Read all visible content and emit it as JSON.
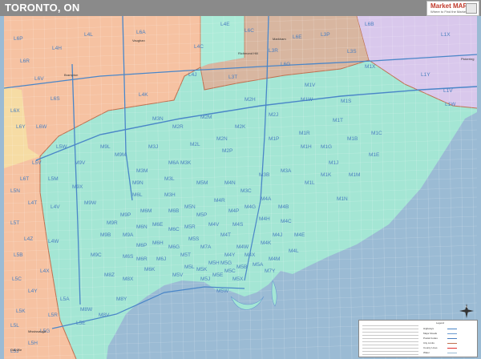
{
  "title": "TORONTO, ON",
  "logo": {
    "brand": "Market MAPS",
    "tagline": "Where to Find the Market"
  },
  "colors": {
    "water": "#9bbbd4",
    "toronto": "#a4e6d4",
    "mississauga": "#f6c2a2",
    "vaughan": "#acebd8",
    "markham": "#d8b6a0",
    "pickering": "#d9c8ec",
    "peel_south": "#f6dca4",
    "label": "#4a7fc0",
    "road": "#6a9ad0",
    "boundary": "#c07050"
  },
  "postal_labels": [
    "L4L",
    "L6A",
    "L4H",
    "L4J",
    "L4C",
    "L3R",
    "L3P",
    "L6E",
    "L6B",
    "L6G",
    "L3S",
    "L1X",
    "L4K",
    "L4E",
    "L6C",
    "L3T",
    "L1Y",
    "L6P",
    "L6R",
    "L6V",
    "L6X",
    "L6S",
    "L6W",
    "L6Y",
    "L6T",
    "L4T",
    "L5T",
    "L4V",
    "L4W",
    "L4X",
    "L4Y",
    "L4Z",
    "L5B",
    "L5C",
    "L5K",
    "L5L",
    "L5M",
    "L5N",
    "L5V",
    "L5W",
    "L5R",
    "L5A",
    "L5E",
    "L5G",
    "L5H",
    "L5J",
    "L1V",
    "L1W",
    "M9L",
    "M3N",
    "M3J",
    "M2N",
    "M2H",
    "M2M",
    "M2L",
    "M2J",
    "M2K",
    "M2P",
    "M1X",
    "M1V",
    "M1W",
    "M1S",
    "M1T",
    "M1R",
    "M1P",
    "M1B",
    "M1C",
    "M1E",
    "M1G",
    "M1H",
    "M1J",
    "M1K",
    "M1L",
    "M1M",
    "M1N",
    "M9V",
    "M9W",
    "M9M",
    "M9N",
    "M9P",
    "M9R",
    "M9C",
    "M9B",
    "M9A",
    "M8V",
    "M8W",
    "M8X",
    "M8Y",
    "M8Z",
    "M3M",
    "M3L",
    "M3K",
    "M3H",
    "M3C",
    "M3B",
    "M3A",
    "M4A",
    "M4B",
    "M4C",
    "M4E",
    "M4G",
    "M4H",
    "M4J",
    "M4K",
    "M4L",
    "M4M",
    "M4N",
    "M4P",
    "M4R",
    "M4S",
    "M4T",
    "M4V",
    "M4W",
    "M4X",
    "M4Y",
    "M5A",
    "M5B",
    "M5C",
    "M5E",
    "M5G",
    "M5H",
    "M5J",
    "M5K",
    "M5L",
    "M5M",
    "M5N",
    "M5P",
    "M5R",
    "M5S",
    "M5T",
    "M5V",
    "M5W",
    "M5X",
    "M6A",
    "M6B",
    "M6C",
    "M6E",
    "M6G",
    "M6H",
    "M6J",
    "M6K",
    "M6L",
    "M6M",
    "M6N",
    "M6P",
    "M6R",
    "M6S",
    "M7A",
    "M7Y",
    "M2R",
    "M9X"
  ],
  "cities": [
    "Vaughan",
    "Markham",
    "Richmond Hill",
    "Brampton",
    "Mississauga",
    "Pickering",
    "Oakville"
  ],
  "legend": {
    "title": "Legend",
    "rows": [
      "Highways",
      "Major Roads",
      "Postal Codes",
      "City Limits",
      "County Lines",
      "Water"
    ]
  },
  "compass_label": "N"
}
